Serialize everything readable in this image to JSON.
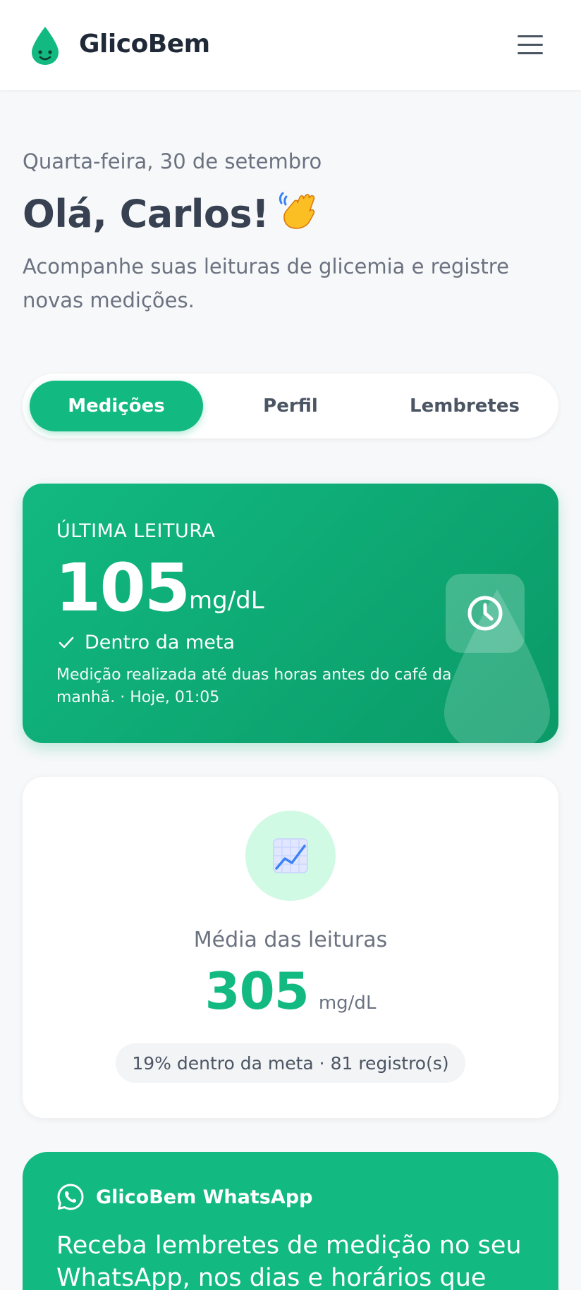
{
  "header": {
    "brand": "GlicoBem",
    "logo_icon": "drop-smile-icon",
    "menu_icon": "hamburger-menu-icon",
    "accent_color": "#12b981"
  },
  "welcome": {
    "date": "Quarta-feira, 30 de setembro",
    "greeting": "Olá, Carlos!",
    "greeting_icon": "waving-hand-icon",
    "intro": "Acompanhe suas leituras de glicemia e registre novas medições."
  },
  "tabs": [
    {
      "label": "Medições",
      "active": true
    },
    {
      "label": "Perfil",
      "active": false
    },
    {
      "label": "Lembretes",
      "active": false
    }
  ],
  "last_reading": {
    "title": "ÚLTIMA LEITURA",
    "value": "105",
    "unit": "mg/dL",
    "status": "Dentro da meta",
    "note": "Medição realizada até duas horas antes do café da manhã. · Hoje, 01:05",
    "icon": "clock-icon"
  },
  "average": {
    "icon": "chart-increasing-icon",
    "label": "Média das leituras",
    "value": "305",
    "unit": "mg/dL",
    "summary": "19% dentro da meta · 81 registro(s)"
  },
  "whatsapp": {
    "icon": "whatsapp-icon",
    "title": "GlicoBem WhatsApp",
    "text": "Receba lembretes de medição no seu WhatsApp, nos dias e horários que"
  }
}
